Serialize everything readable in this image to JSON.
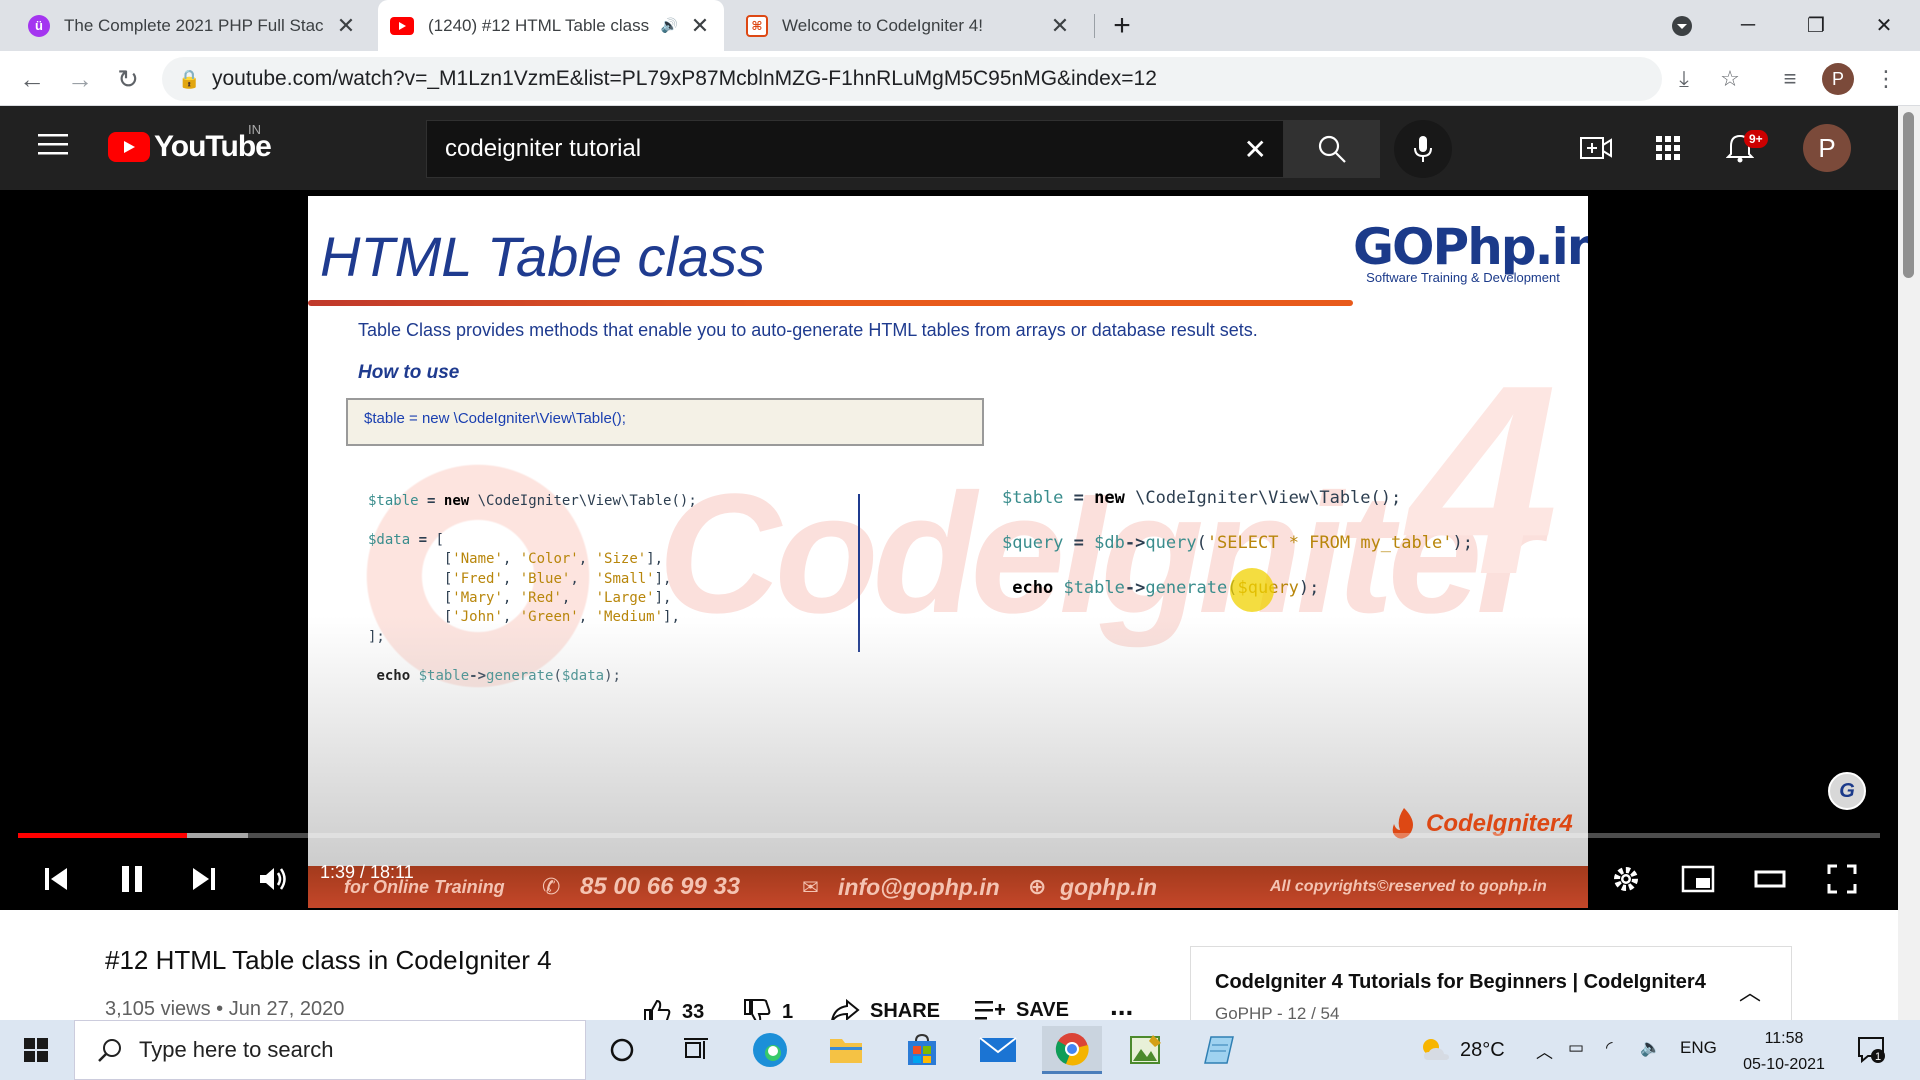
{
  "browser": {
    "tabs": [
      {
        "title": "The Complete 2021 PHP Full Stac",
        "favicon": "udemy-icon",
        "active": false
      },
      {
        "title": "(1240) #12 HTML Table class",
        "favicon": "youtube-icon",
        "active": true
      },
      {
        "title": "Welcome to CodeIgniter 4!",
        "favicon": "codeigniter-icon",
        "active": false
      }
    ],
    "url": "youtube.com/watch?v=_M1Lzn1VzmE&list=PL79xP87McblnMZG-F1hnRLuMgM5C95nMG&index=12",
    "profile_initial": "P"
  },
  "youtube": {
    "logo_text": "YouTube",
    "country_code": "IN",
    "search_value": "codeigniter tutorial",
    "notification_badge": "9+",
    "avatar_initial": "P"
  },
  "slide": {
    "title": "HTML Table class",
    "brand_name": "GOPhp.in",
    "brand_tagline": "Software Training & Development",
    "description": "Table Class provides methods that enable you to auto-generate HTML tables from arrays or database result sets.",
    "howto": "How to  use",
    "init_code": "$table = new \\CodeIgniter\\View\\Table();",
    "footer_training": "for Online Training",
    "footer_phone": "85 00 66 99 33",
    "footer_email": "info@gophp.in",
    "footer_web": "gophp.in",
    "footer_copyright": "All copyrights©reserved to gophp.in",
    "ci_brand": "CodeIgniter4",
    "g_badge": "G"
  },
  "player": {
    "time": "1:39 / 18:11",
    "progress_fraction": 0.091
  },
  "video": {
    "title": "#12 HTML Table class in CodeIgniter 4",
    "meta": "3,105 views • Jun 27, 2020",
    "likes": "33",
    "dislikes": "1",
    "share_label": "SHARE",
    "save_label": "SAVE",
    "more_label": "..."
  },
  "playlist": {
    "title": "CodeIgniter 4 Tutorials for Beginners | CodeIgniter4",
    "subtitle": "GoPHP - 12 / 54"
  },
  "taskbar": {
    "search_placeholder": "Type here to search",
    "temperature": "28°C",
    "language": "ENG",
    "time": "11:58",
    "date": "05-10-2021",
    "notification_count": "1"
  }
}
